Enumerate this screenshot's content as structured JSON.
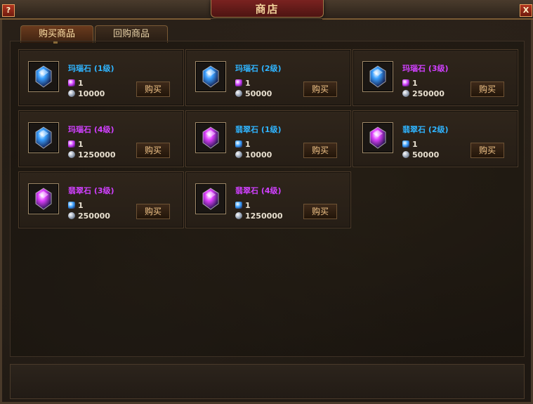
{
  "window": {
    "title": "商店",
    "help": "?",
    "close": "X"
  },
  "tabs": [
    {
      "label": "购买商品",
      "active": true
    },
    {
      "label": "回购商品",
      "active": false
    }
  ],
  "items": [
    {
      "name": "玛瑙石 (1级)",
      "name_color": "#2fb4ff",
      "gem": "blue-gem-icon",
      "gem_color": "#3aa0ff",
      "currency_gem_color": "#d040ff",
      "currency_qty": "1",
      "silver": "10000",
      "buy_label": "购买"
    },
    {
      "name": "玛瑙石 (2级)",
      "name_color": "#2fb4ff",
      "gem": "blue-gem-icon",
      "gem_color": "#3aa0ff",
      "currency_gem_color": "#d040ff",
      "currency_qty": "1",
      "silver": "50000",
      "buy_label": "购买"
    },
    {
      "name": "玛瑙石 (3级)",
      "name_color": "#d040ff",
      "gem": "blue-gem-icon",
      "gem_color": "#3aa0ff",
      "currency_gem_color": "#d040ff",
      "currency_qty": "1",
      "silver": "250000",
      "buy_label": "购买"
    },
    {
      "name": "玛瑙石 (4级)",
      "name_color": "#d040ff",
      "gem": "blue-gem-icon",
      "gem_color": "#3aa0ff",
      "currency_gem_color": "#d040ff",
      "currency_qty": "1",
      "silver": "1250000",
      "buy_label": "购买"
    },
    {
      "name": "翡翠石 (1级)",
      "name_color": "#2fb4ff",
      "gem": "purple-gem-icon",
      "gem_color": "#e040ff",
      "currency_gem_color": "#3aa0ff",
      "currency_qty": "1",
      "silver": "10000",
      "buy_label": "购买"
    },
    {
      "name": "翡翠石 (2级)",
      "name_color": "#2fb4ff",
      "gem": "purple-gem-icon",
      "gem_color": "#e040ff",
      "currency_gem_color": "#3aa0ff",
      "currency_qty": "1",
      "silver": "50000",
      "buy_label": "购买"
    },
    {
      "name": "翡翠石 (3级)",
      "name_color": "#d040ff",
      "gem": "purple-gem-icon",
      "gem_color": "#e040ff",
      "currency_gem_color": "#3aa0ff",
      "currency_qty": "1",
      "silver": "250000",
      "buy_label": "购买"
    },
    {
      "name": "翡翠石 (4级)",
      "name_color": "#d040ff",
      "gem": "purple-gem-icon",
      "gem_color": "#e040ff",
      "currency_gem_color": "#3aa0ff",
      "currency_qty": "1",
      "silver": "1250000",
      "buy_label": "购买"
    }
  ]
}
